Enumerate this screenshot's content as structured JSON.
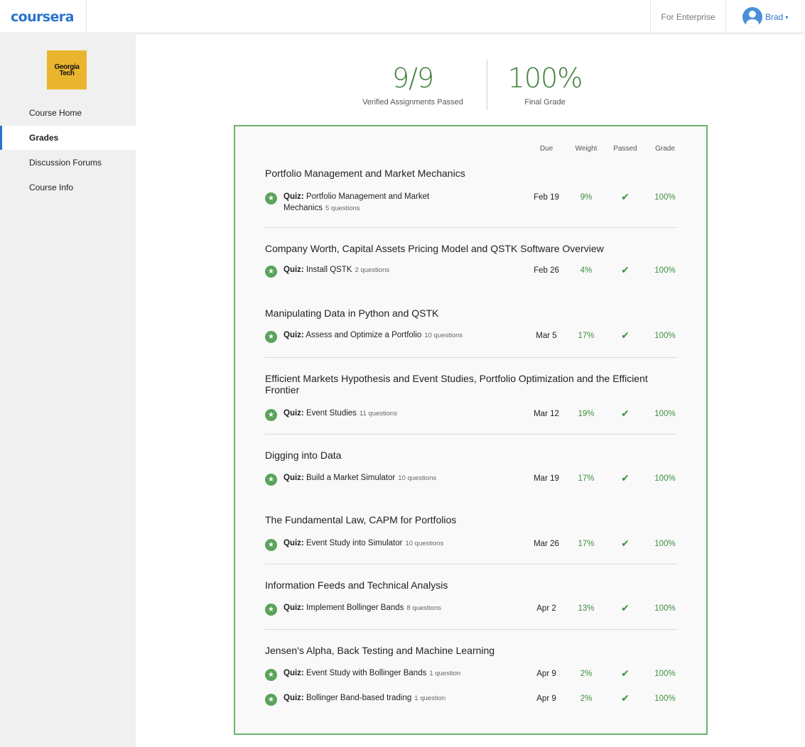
{
  "header": {
    "logo_text": "coursera",
    "enterprise_label": "For Enterprise",
    "user_name": "Brad",
    "user_caret": "▾"
  },
  "sidebar": {
    "logo_text": "Georgia\nTech",
    "items": [
      {
        "label": "Course Home",
        "active": false
      },
      {
        "label": "Grades",
        "active": true
      },
      {
        "label": "Discussion Forums",
        "active": false
      },
      {
        "label": "Course Info",
        "active": false
      }
    ]
  },
  "summary": {
    "assignments_value": "9/9",
    "assignments_label": "Verified Assignments Passed",
    "grade_value": "100%",
    "grade_label": "Final Grade"
  },
  "table": {
    "headers": {
      "due": "Due",
      "weight": "Weight",
      "passed": "Passed",
      "grade": "Grade"
    },
    "quiz_prefix": "Quiz:",
    "check_glyph": "✔",
    "star_glyph": "★",
    "sections": [
      {
        "title": "Portfolio Management and Market Mechanics",
        "items": [
          {
            "name": "Portfolio Management and Market Mechanics",
            "questions": "5 questions",
            "due": "Feb 19",
            "weight": "9%",
            "grade": "100%",
            "passed": true
          }
        ]
      },
      {
        "title": "Company Worth, Capital Assets Pricing Model and QSTK Software Overview",
        "items": [
          {
            "name": "Install QSTK",
            "questions": "2 questions",
            "due": "Feb 26",
            "weight": "4%",
            "grade": "100%",
            "passed": true
          }
        ]
      },
      {
        "title": "Manipulating Data in Python and QSTK",
        "items": [
          {
            "name": "Assess and Optimize a Portfolio",
            "questions": "10 questions",
            "due": "Mar 5",
            "weight": "17%",
            "grade": "100%",
            "passed": true
          }
        ]
      },
      {
        "title": "Efficient Markets Hypothesis and Event Studies, Portfolio Optimization and the Efficient Frontier",
        "items": [
          {
            "name": "Event Studies",
            "questions": "11 questions",
            "due": "Mar 12",
            "weight": "19%",
            "grade": "100%",
            "passed": true
          }
        ]
      },
      {
        "title": "Digging into Data",
        "items": [
          {
            "name": "Build a Market Simulator",
            "questions": "10 questions",
            "due": "Mar 19",
            "weight": "17%",
            "grade": "100%",
            "passed": true
          }
        ]
      },
      {
        "title": "The Fundamental Law, CAPM for Portfolios",
        "items": [
          {
            "name": "Event Study into Simulator",
            "questions": "10 questions",
            "due": "Mar 26",
            "weight": "17%",
            "grade": "100%",
            "passed": true
          }
        ]
      },
      {
        "title": "Information Feeds and Technical Analysis",
        "items": [
          {
            "name": "Implement Bollinger Bands",
            "questions": "8 questions",
            "due": "Apr 2",
            "weight": "13%",
            "grade": "100%",
            "passed": true
          }
        ]
      },
      {
        "title": "Jensen's Alpha, Back Testing and Machine Learning",
        "items": [
          {
            "name": "Event Study with Bollinger Bands",
            "questions": "1 question",
            "due": "Apr 9",
            "weight": "2%",
            "grade": "100%",
            "passed": true
          },
          {
            "name": "Bollinger Band-based trading",
            "questions": "1 question",
            "due": "Apr 9",
            "weight": "2%",
            "grade": "100%",
            "passed": true
          }
        ]
      }
    ]
  }
}
